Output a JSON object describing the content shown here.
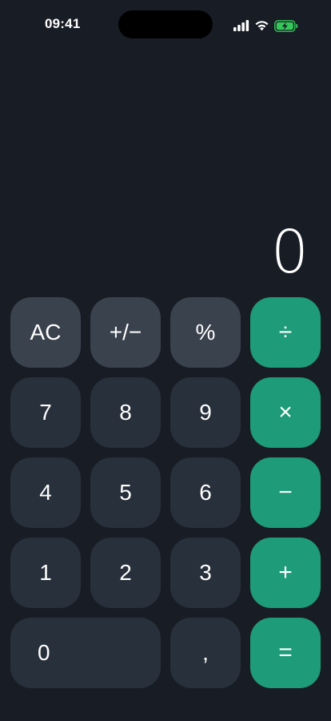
{
  "status_bar": {
    "time": "09:41",
    "signal_icon": "cellular-signal-icon",
    "wifi_icon": "wifi-icon",
    "battery_icon": "battery-charging-icon",
    "battery_color": "#34c759"
  },
  "display": {
    "value": "0"
  },
  "keys": {
    "clear": "AC",
    "sign": "+/−",
    "percent": "%",
    "divide": "÷",
    "seven": "7",
    "eight": "8",
    "nine": "9",
    "multiply": "×",
    "four": "4",
    "five": "5",
    "six": "6",
    "minus": "−",
    "one": "1",
    "two": "2",
    "three": "3",
    "plus": "+",
    "zero": "0",
    "decimal": ",",
    "equals": "="
  },
  "colors": {
    "background": "#181d25",
    "function_key": "#3a424e",
    "number_key": "#28303b",
    "operator_key": "#1e9b78"
  }
}
